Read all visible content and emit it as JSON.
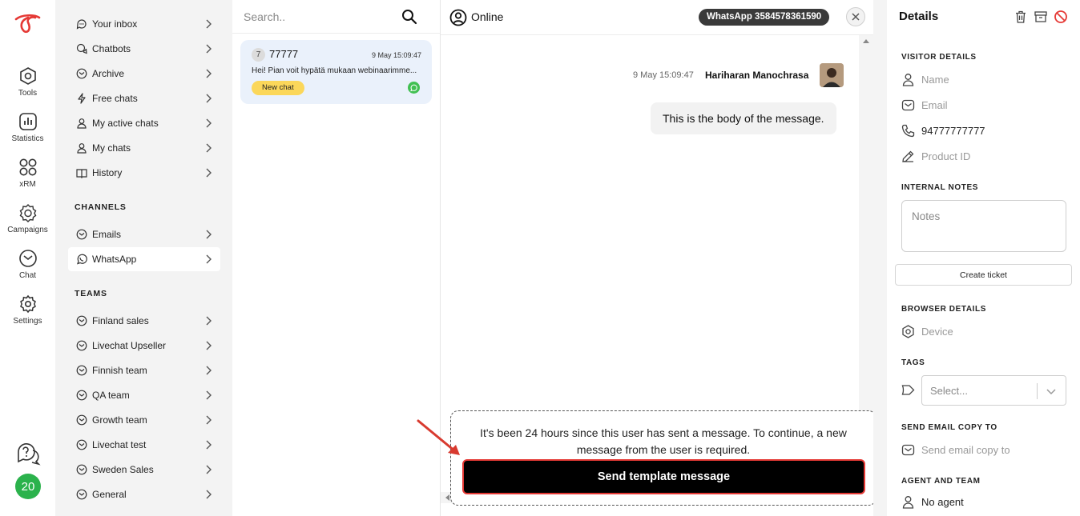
{
  "colors": {
    "accent_red": "#e53935",
    "online_green": "#2bb24c",
    "badge_yellow": "#fbd75a",
    "whatsapp_green": "#41c052"
  },
  "rail": {
    "items": [
      {
        "label": "Tools",
        "icon": "tools-icon"
      },
      {
        "label": "Statistics",
        "icon": "statistics-icon"
      },
      {
        "label": "xRM",
        "icon": "xrm-grid-icon"
      },
      {
        "label": "Campaigns",
        "icon": "campaigns-icon"
      },
      {
        "label": "Chat",
        "icon": "chat-icon"
      },
      {
        "label": "Settings",
        "icon": "gear-icon"
      }
    ],
    "badge_count": "20"
  },
  "nav": {
    "items": [
      {
        "label": "Your inbox",
        "icon": "inbox-chat-icon"
      },
      {
        "label": "Chatbots",
        "icon": "chatbot-icon"
      },
      {
        "label": "Archive",
        "icon": "archive-chat-icon"
      },
      {
        "label": "Free chats",
        "icon": "lightning-icon"
      },
      {
        "label": "My active chats",
        "icon": "user-icon"
      },
      {
        "label": "My chats",
        "icon": "user-icon"
      },
      {
        "label": "History",
        "icon": "book-icon"
      }
    ],
    "channels_heading": "CHANNELS",
    "channels": [
      {
        "label": "Emails",
        "icon": "email-icon"
      },
      {
        "label": "WhatsApp",
        "icon": "whatsapp-icon"
      }
    ],
    "teams_heading": "TEAMS",
    "teams": [
      {
        "label": "Finland sales"
      },
      {
        "label": "Livechat Upseller"
      },
      {
        "label": "Finnish team"
      },
      {
        "label": "QA team"
      },
      {
        "label": "Growth team"
      },
      {
        "label": "Livechat test"
      },
      {
        "label": "Sweden Sales"
      },
      {
        "label": "General"
      }
    ]
  },
  "list": {
    "search_placeholder": "Search..",
    "chat": {
      "count": "7",
      "name": "77777",
      "time": "9 May 15:09:47",
      "preview": "Hei! Pian voit hypätä mukaan webinaarimme...",
      "badge": "New chat"
    }
  },
  "conversation": {
    "status": "Online",
    "channel_pill": "WhatsApp 3584578361590",
    "message": {
      "time": "9 May 15:09:47",
      "sender": "Hariharan Manochrasa",
      "body": "This is the body of the message."
    },
    "notice": "It's been 24 hours since this user has sent a message. To continue, a new message from the user is required.",
    "template_button": "Send template message"
  },
  "details": {
    "title": "Details",
    "visitor_heading": "VISITOR DETAILS",
    "name_placeholder": "Name",
    "email_placeholder": "Email",
    "phone": "94777777777",
    "product_placeholder": "Product ID",
    "notes_heading": "INTERNAL NOTES",
    "notes_placeholder": "Notes",
    "ticket_button": "Create ticket",
    "browser_heading": "BROWSER DETAILS",
    "device_placeholder": "Device",
    "tags_heading": "TAGS",
    "tags_placeholder": "Select...",
    "email_copy_heading": "SEND EMAIL COPY TO",
    "email_copy_placeholder": "Send email copy to",
    "agent_heading": "AGENT AND TEAM",
    "agent_value": "No agent"
  }
}
